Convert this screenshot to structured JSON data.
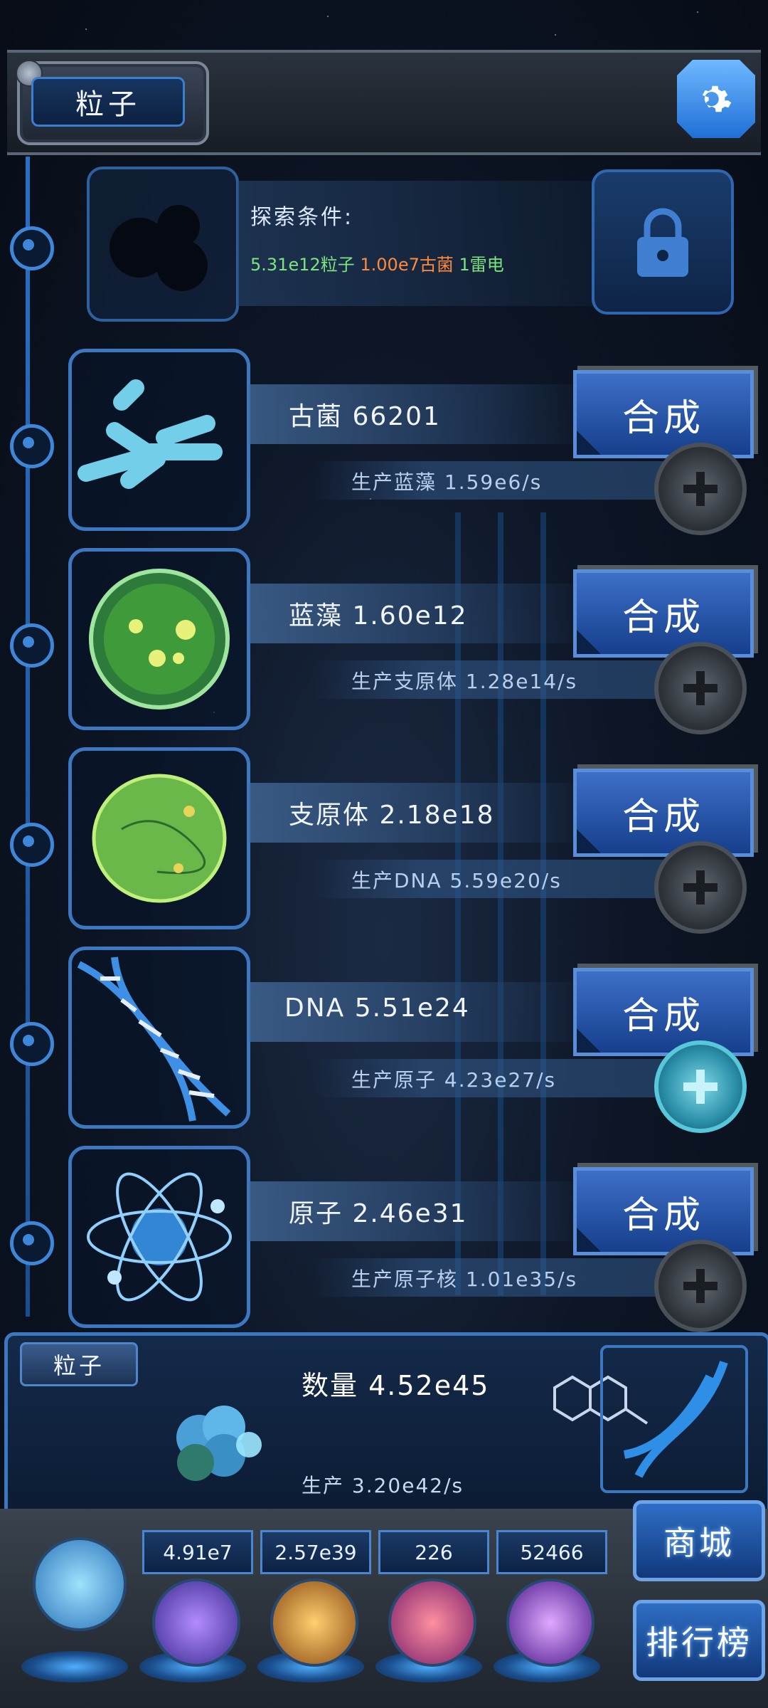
{
  "header": {
    "title": "粒子",
    "settings_icon": "gear-icon"
  },
  "explore": {
    "label": "探索条件:",
    "req_particles": "5.31e12粒子",
    "req_archaea": "1.00e7古菌",
    "req_thunder": "1雷电",
    "lock_icon": "lock-icon"
  },
  "rows": [
    {
      "name": "古菌 66201",
      "production": "生产蓝藻 1.59e6/s",
      "synth_label": "合成",
      "icon": "bacteria-icon"
    },
    {
      "name": "蓝藻 1.60e12",
      "production": "生产支原体 1.28e14/s",
      "synth_label": "合成",
      "icon": "cyanobacteria-icon"
    },
    {
      "name": "支原体 2.18e18",
      "production": "生产DNA 5.59e20/s",
      "synth_label": "合成",
      "icon": "mycoplasma-icon"
    },
    {
      "name": "DNA 5.51e24",
      "production": "生产原子 4.23e27/s",
      "synth_label": "合成",
      "icon": "dna-icon"
    },
    {
      "name": "原子 2.46e31",
      "production": "生产原子核 1.01e35/s",
      "synth_label": "合成",
      "icon": "atom-icon"
    }
  ],
  "panel": {
    "title": "粒子",
    "count": "数量 4.52e45",
    "production": "生产 3.20e42/s"
  },
  "resources": [
    "4.91e7",
    "2.57e39",
    "226",
    "52466"
  ],
  "side_buttons": {
    "shop": "商城",
    "ranking": "排行榜"
  },
  "colors": {
    "accent": "#3c78c2",
    "req_green": "#7de37d",
    "req_orange": "#ff8a3c"
  }
}
